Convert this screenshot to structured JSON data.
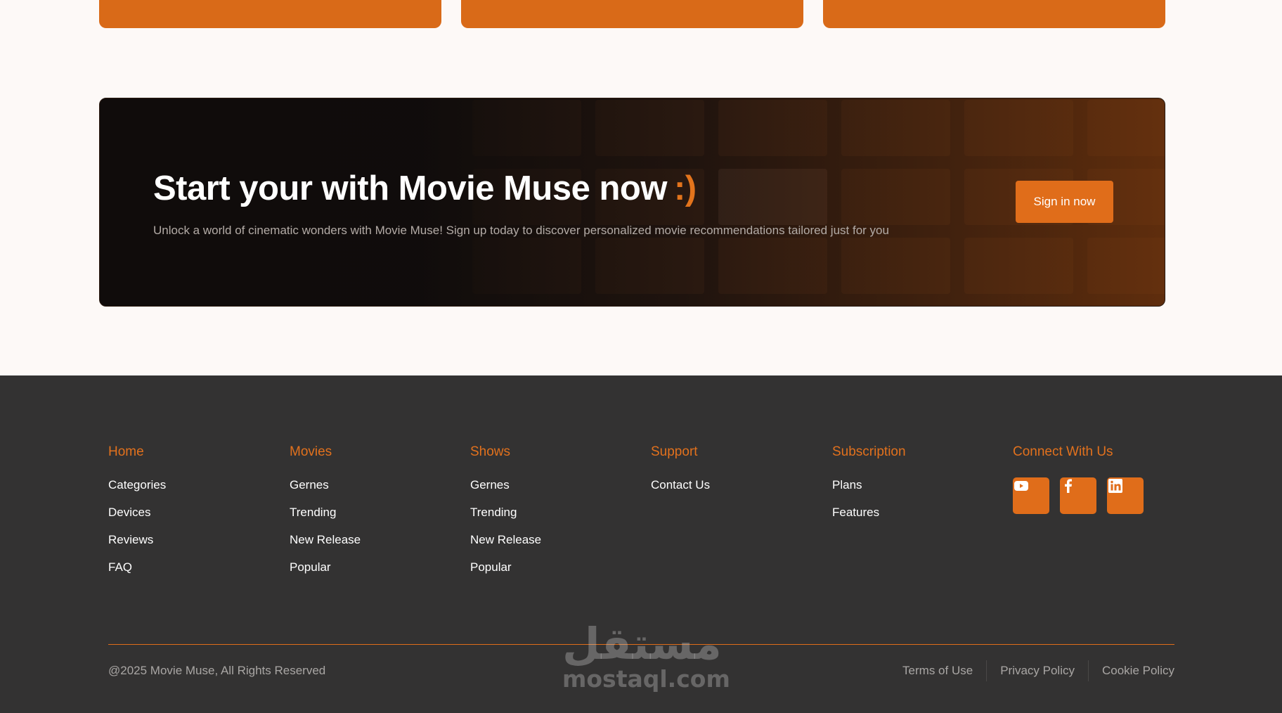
{
  "cta": {
    "title": "Start your with Movie Muse now",
    "smile": ":)",
    "subtitle": "Unlock a world of cinematic wonders with Movie Muse! Sign up today to discover personalized movie recommendations tailored just for you",
    "button": "Sign in now"
  },
  "footer": {
    "columns": [
      {
        "heading": "Home",
        "links": [
          "Categories",
          "Devices",
          "Reviews",
          "FAQ"
        ]
      },
      {
        "heading": "Movies",
        "links": [
          "Gernes",
          "Trending",
          "New Release",
          "Popular"
        ]
      },
      {
        "heading": "Shows",
        "links": [
          "Gernes",
          "Trending",
          "New Release",
          "Popular"
        ]
      },
      {
        "heading": "Support",
        "links": [
          "Contact Us"
        ]
      },
      {
        "heading": "Subscription",
        "links": [
          "Plans",
          "Features"
        ]
      }
    ],
    "connect": {
      "heading": "Connect With Us",
      "icons": [
        "youtube-icon",
        "facebook-icon",
        "linkedin-icon"
      ]
    },
    "copyright": "@2025 Movie Muse, All Rights Reserved",
    "legal": [
      "Terms of Use",
      "Privacy Policy",
      "Cookie Policy"
    ]
  },
  "watermark": {
    "arabic": "مستقل",
    "latin": "mostaql.com"
  },
  "colors": {
    "accent": "#e06d1a",
    "footer_bg": "#333232",
    "page_bg": "#fdf9f7"
  }
}
